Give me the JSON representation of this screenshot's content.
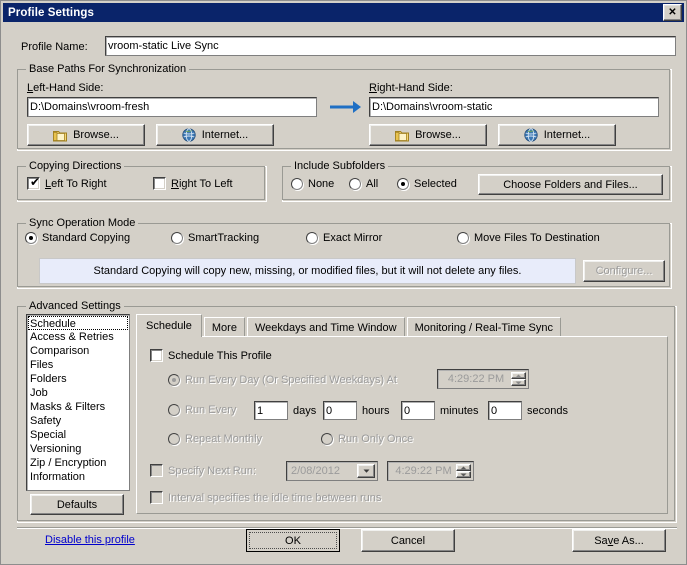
{
  "window": {
    "title": "Profile Settings",
    "close_label": "✕"
  },
  "profile": {
    "name_label": "Profile Name:",
    "name_value": "vroom-static Live Sync"
  },
  "base_paths": {
    "group_title": "Base Paths For Synchronization",
    "left_label": "Left-Hand Side:",
    "left_value": "D:\\Domains\\vroom-fresh",
    "right_label": "Right-Hand Side:",
    "right_value": "D:\\Domains\\vroom-static",
    "browse_label": "Browse...",
    "internet_label": "Internet...",
    "arrow_icon": "arrow-right-icon",
    "arrow_color": "#1f6fc4"
  },
  "copying_directions": {
    "group_title": "Copying Directions",
    "left_to_right_label": "Left To Right",
    "left_to_right_checked": true,
    "right_to_left_label": "Right To Left",
    "right_to_left_checked": false
  },
  "include_subfolders": {
    "group_title": "Include Subfolders",
    "options": [
      {
        "label": "None",
        "selected": false
      },
      {
        "label": "All",
        "selected": false
      },
      {
        "label": "Selected",
        "selected": true
      }
    ],
    "choose_button_label": "Choose Folders and Files..."
  },
  "sync_mode": {
    "group_title": "Sync Operation Mode",
    "options": [
      {
        "label": "Standard Copying",
        "selected": true
      },
      {
        "label": "SmartTracking",
        "selected": false
      },
      {
        "label": "Exact Mirror",
        "selected": false
      },
      {
        "label": "Move Files To Destination",
        "selected": false
      }
    ],
    "info_text": "Standard Copying will copy new, missing, or modified files, but it will not delete any files.",
    "info_bg": "#e8ecfa",
    "configure_label": "Configure...",
    "configure_disabled": true
  },
  "advanced_settings": {
    "group_title": "Advanced Settings",
    "items": [
      {
        "label": "Schedule",
        "selected": true
      },
      {
        "label": "Access & Retries",
        "selected": false
      },
      {
        "label": "Comparison",
        "selected": false
      },
      {
        "label": "Files",
        "selected": false
      },
      {
        "label": "Folders",
        "selected": false
      },
      {
        "label": "Job",
        "selected": false
      },
      {
        "label": "Masks & Filters",
        "selected": false
      },
      {
        "label": "Safety",
        "selected": false
      },
      {
        "label": "Special",
        "selected": false
      },
      {
        "label": "Versioning",
        "selected": false
      },
      {
        "label": "Zip / Encryption",
        "selected": false
      },
      {
        "label": "Information",
        "selected": false
      }
    ],
    "defaults_label": "Defaults"
  },
  "tabs": [
    {
      "label": "Schedule",
      "active": true
    },
    {
      "label": "More",
      "active": false
    },
    {
      "label": "Weekdays and Time Window",
      "active": false
    },
    {
      "label": "Monitoring / Real-Time Sync",
      "active": false
    }
  ],
  "schedule": {
    "enable_label": "Schedule This Profile",
    "enable_checked": false,
    "run_every_day_label": "Run Every Day (Or Specified Weekdays) At",
    "run_every_day_selected": true,
    "run_every_day_time": "4:29:22 PM",
    "run_every_label": "Run Every",
    "run_every_selected": false,
    "days_value": "1",
    "days_label": "days",
    "hours_value": "0",
    "hours_label": "hours",
    "minutes_value": "0",
    "minutes_label": "minutes",
    "seconds_value": "0",
    "seconds_label": "seconds",
    "repeat_monthly_label": "Repeat Monthly",
    "repeat_monthly_selected": false,
    "run_only_once_label": "Run Only Once",
    "run_only_once_selected": false,
    "specify_next_run_label": "Specify Next Run:",
    "specify_next_run_checked": false,
    "next_run_date": "2/08/2012",
    "next_run_time": "4:29:22 PM",
    "interval_label": "Interval specifies the idle time between runs",
    "interval_checked": false
  },
  "footer": {
    "disable_link": "Disable this profile",
    "ok_label": "OK",
    "cancel_label": "Cancel",
    "save_as_label": "Save As..."
  }
}
